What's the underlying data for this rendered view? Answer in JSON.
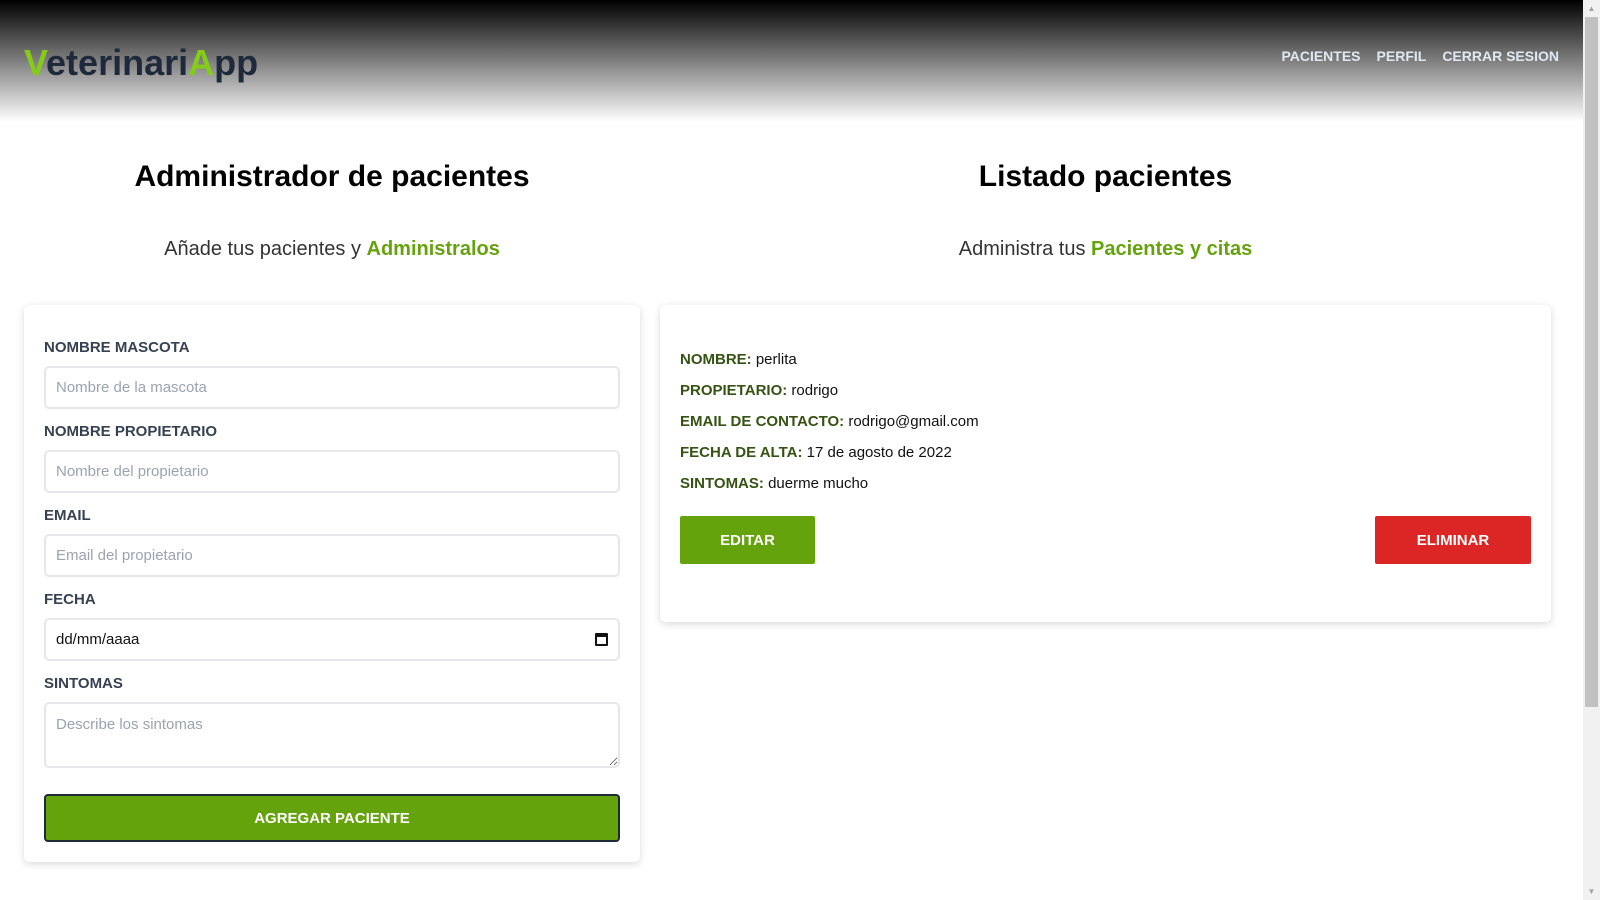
{
  "header": {
    "logo_first": "V",
    "logo_mid": "eterinari",
    "logo_a": "A",
    "logo_end": "pp",
    "nav": [
      "PACIENTES",
      "PERFIL",
      "CERRAR SESION"
    ]
  },
  "left": {
    "title": "Administrador de pacientes",
    "subtitle": "Añade tus pacientes y ",
    "subtitle_accent": "Administralos",
    "form": {
      "pet_label": "NOMBRE MASCOTA",
      "pet_placeholder": "Nombre de la mascota",
      "owner_label": "NOMBRE PROPIETARIO",
      "owner_placeholder": "Nombre del propietario",
      "email_label": "EMAIL",
      "email_placeholder": "Email del propietario",
      "date_label": "FECHA",
      "date_value": "dd/mm/aaaa",
      "symptoms_label": "SINTOMAS",
      "symptoms_placeholder": "Describe los sintomas",
      "submit": "AGREGAR PACIENTE"
    }
  },
  "right": {
    "title": "Listado pacientes",
    "subtitle": "Administra tus ",
    "subtitle_accent": "Pacientes y citas",
    "patients": [
      {
        "name_label": "Nombre:",
        "name": "perlita",
        "owner_label": "Propietario:",
        "owner": "rodrigo",
        "email_label": "Email de contacto:",
        "email": "rodrigo@gmail.com",
        "date_label": "Fecha de alta:",
        "date": "17 de agosto de 2022",
        "symptoms_label": "Sintomas:",
        "symptoms": "duerme mucho",
        "edit": "EDITAR",
        "delete": "ELIMINAR"
      }
    ]
  }
}
